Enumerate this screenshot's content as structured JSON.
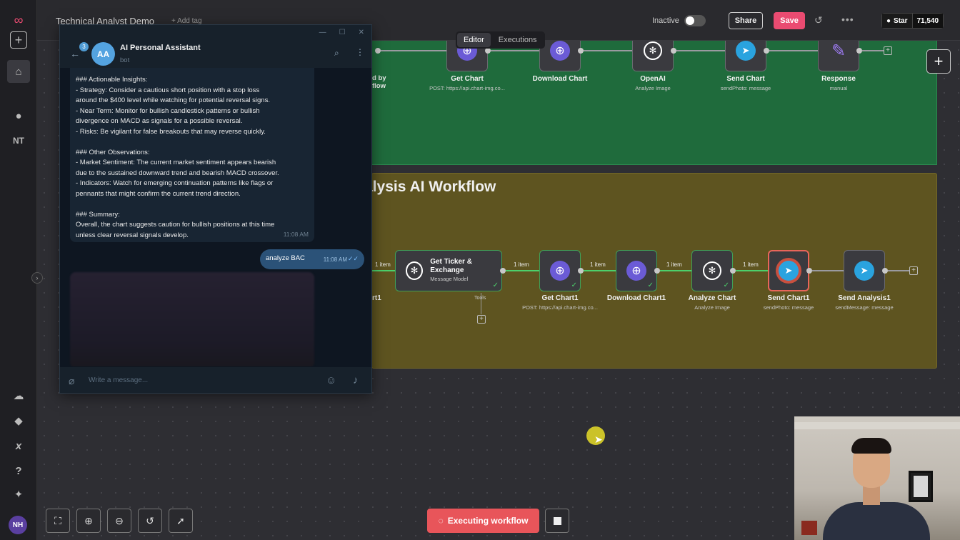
{
  "header": {
    "workflow_title": "Technical Analyst Demo",
    "add_tag": "+ Add tag",
    "status": "Inactive",
    "share": "Share",
    "save": "Save",
    "github_star": "Star",
    "github_count": "71,540"
  },
  "tabs": [
    "Editor",
    "Executions"
  ],
  "sidebar": {
    "nt": "NT",
    "avatar": "NH"
  },
  "top_flow": {
    "partial_trigger_label": "d by\nflow",
    "nodes": [
      {
        "label": "Get Chart",
        "sub": "POST: https://api.chart-img.co..."
      },
      {
        "label": "Download Chart",
        "sub": ""
      },
      {
        "label": "OpenAI",
        "sub": "Analyze Image"
      },
      {
        "label": "Send Chart",
        "sub": "sendPhoto: message"
      },
      {
        "label": "Response",
        "sub": "manual"
      }
    ]
  },
  "bottom_flow": {
    "title": "alysis AI Workflow",
    "partial_label": "rt1",
    "tools_label": "Tools",
    "item_label": "1 item",
    "nodes": [
      {
        "label": "Get Ticker & Exchange",
        "sub": "Message Model"
      },
      {
        "label": "Get Chart1",
        "sub": "POST: https://api.chart-img.co..."
      },
      {
        "label": "Download Chart1",
        "sub": ""
      },
      {
        "label": "Analyze Chart",
        "sub": "Analyze Image"
      },
      {
        "label": "Send Chart1",
        "sub": "sendPhoto: message"
      },
      {
        "label": "Send Analysis1",
        "sub": "sendMessage: message"
      }
    ]
  },
  "telegram": {
    "badge": "3",
    "avatar": "AA",
    "name": "AI Personal Assistant",
    "status": "bot",
    "message_in": "### Actionable Insights:\n- Strategy: Consider a cautious short position with a stop loss\naround the $400 level while watching for potential reversal signs.\n- Near Term: Monitor for bullish candlestick patterns or bullish\ndivergence on MACD as signals for a possible reversal.\n- Risks: Be vigilant for false breakouts that may reverse quickly.\n\n### Other Observations:\n- Market Sentiment: The current market sentiment appears bearish\ndue to the sustained downward trend and bearish MACD crossover.\n- Indicators: Watch for emerging continuation patterns like flags or\npennants that might confirm the current trend direction.\n\n### Summary:\nOverall, the chart suggests caution for bullish positions at this time\nunless clear reversal signals develop.",
    "message_in_time": "11:08 AM",
    "message_out": "analyze BAC",
    "message_out_time": "11:08 AM",
    "input_placeholder": "Write a message..."
  },
  "bottom_bar": {
    "executing": "Executing workflow"
  }
}
